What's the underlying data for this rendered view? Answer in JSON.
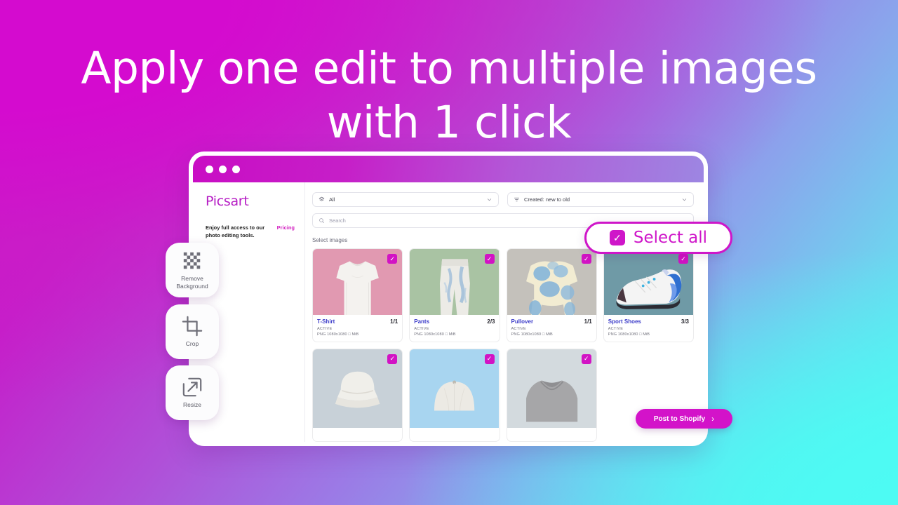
{
  "headline": {
    "line1": "Apply one edit to multiple images",
    "line2": "with 1 click"
  },
  "colors": {
    "brand_magenta": "#d20bcc",
    "accent_cyan": "#4dfbf3",
    "accent_purple": "#a75fd8",
    "checkbox": "#d213c4",
    "title_link": "#3b3bc9"
  },
  "window": {
    "titlebar_dots": 3
  },
  "sidebar": {
    "brand": "Picsart",
    "promo_text": "Enjoy full access to our photo editing tools.",
    "promo_link": "Pricing"
  },
  "toolbar": {
    "filter": {
      "icon": "layers-icon",
      "value": "All",
      "chevron": "chevron-down-icon"
    },
    "sort": {
      "icon": "sort-filter-icon",
      "value": "Created: new to old",
      "chevron": "chevron-down-icon"
    },
    "search": {
      "icon": "search-icon",
      "placeholder": "Search",
      "value": ""
    }
  },
  "main": {
    "select_images_label": "Select images"
  },
  "tools": [
    {
      "name": "remove-background",
      "icon": "checkerboard-icon",
      "label_line1": "Remove",
      "label_line2": "Background"
    },
    {
      "name": "crop",
      "icon": "crop-icon",
      "label_line1": "Crop",
      "label_line2": ""
    },
    {
      "name": "resize",
      "icon": "resize-arrow-icon",
      "label_line1": "Resize",
      "label_line2": ""
    }
  ],
  "select_all": {
    "label": "Select all",
    "checked": true,
    "check_glyph": "✓"
  },
  "post_button": {
    "label": "Post to Shopify",
    "arrow": "›"
  },
  "products": [
    {
      "title": "T-Shirt",
      "count": "1/1",
      "status": "ACTIVE",
      "specs": "PNG 1080x1080 □ MiB",
      "checked": true,
      "art": "tshirt-white-on-pink"
    },
    {
      "title": "Pants",
      "count": "2/3",
      "status": "ACTIVE",
      "specs": "PNG 1080x1080 □ MiB",
      "checked": true,
      "art": "tiedye-pants-on-green"
    },
    {
      "title": "Pullover",
      "count": "1/1",
      "status": "ACTIVE",
      "specs": "PNG 1080x1080 □ MiB",
      "checked": true,
      "art": "tiedye-pullover-on-concrete"
    },
    {
      "title": "Sport Shoes",
      "count": "3/3",
      "status": "ACTIVE",
      "specs": "PNG 1080x1080 □ MiB",
      "checked": true,
      "art": "sneaker-on-teal"
    }
  ],
  "products_row2": [
    {
      "checked": true,
      "art": "bucket-hat-on-grey"
    },
    {
      "checked": true,
      "art": "cap-on-blue"
    },
    {
      "checked": true,
      "art": "grey-sweatshirt"
    }
  ]
}
